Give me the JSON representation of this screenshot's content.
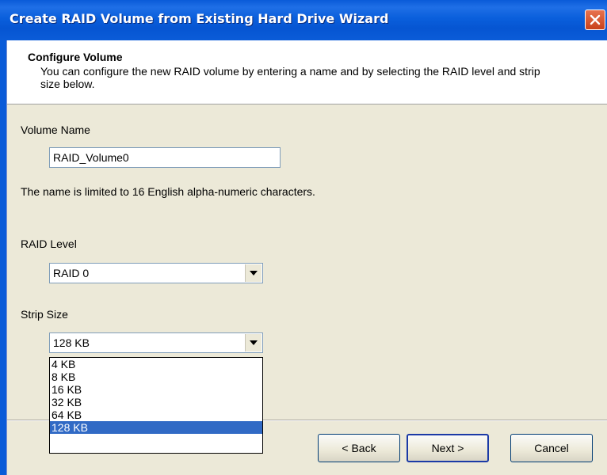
{
  "window": {
    "title": "Create RAID Volume from Existing Hard Drive Wizard"
  },
  "header": {
    "title": "Configure Volume",
    "description": "You can configure the new RAID volume by entering a name and by selecting the RAID level and strip size below."
  },
  "form": {
    "volume_name_label": "Volume Name",
    "volume_name_value": "RAID_Volume0",
    "volume_name_hint": "The name is limited to 16 English alpha-numeric characters.",
    "raid_level_label": "RAID Level",
    "raid_level_value": "RAID 0",
    "strip_size_label": "Strip Size",
    "strip_size_value": "128 KB",
    "strip_size_options": [
      "4 KB",
      "8 KB",
      "16 KB",
      "32 KB",
      "64 KB",
      "128 KB"
    ],
    "strip_size_selected_index": 5
  },
  "buttons": {
    "back": "< Back",
    "next": "Next >",
    "cancel": "Cancel"
  },
  "colors": {
    "titlebar": "#0a5bd8",
    "selection": "#316ac5",
    "close_button": "#d9562e"
  },
  "icons": {
    "close": "close-icon",
    "dropdown_arrow": "chevron-down-icon"
  }
}
